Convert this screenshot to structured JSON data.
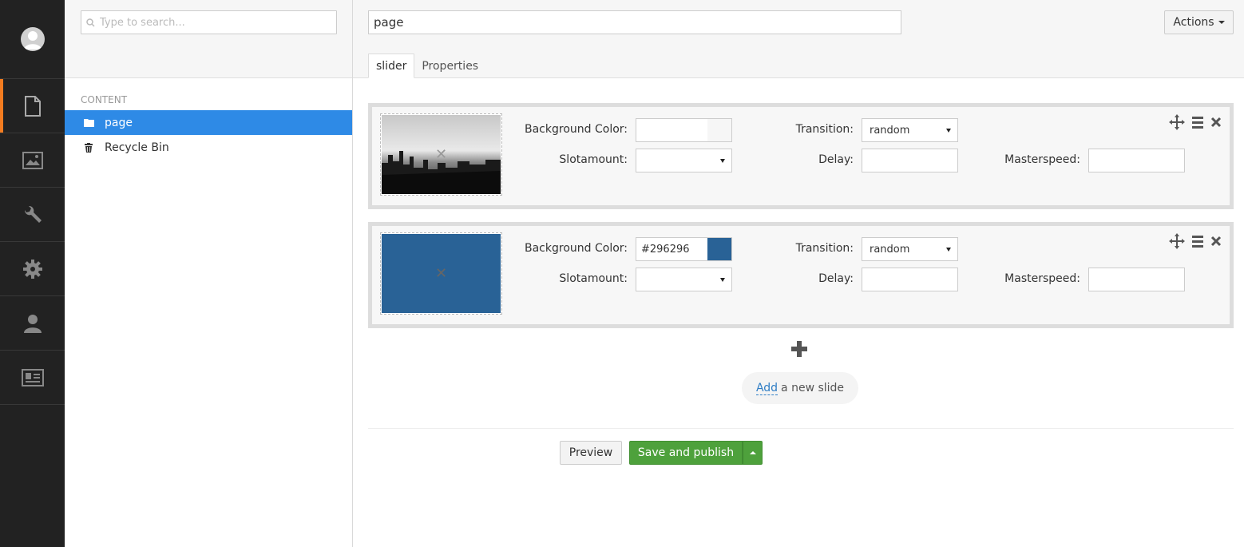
{
  "nav": {
    "items": [
      {
        "icon": "document-icon",
        "active": true
      },
      {
        "icon": "image-icon",
        "active": false
      },
      {
        "icon": "wrench-icon",
        "active": false
      },
      {
        "icon": "gear-icon",
        "active": false
      },
      {
        "icon": "user-icon",
        "active": false
      },
      {
        "icon": "id-card-icon",
        "active": false
      }
    ]
  },
  "tree": {
    "search_placeholder": "Type to search...",
    "section_label": "CONTENT",
    "items": [
      {
        "label": "page",
        "icon": "folder-icon",
        "selected": true
      },
      {
        "label": "Recycle Bin",
        "icon": "trash-icon",
        "selected": false
      }
    ]
  },
  "header": {
    "name_value": "page",
    "actions_label": "Actions",
    "tabs": [
      {
        "label": "slider",
        "active": true
      },
      {
        "label": "Properties",
        "active": false
      }
    ]
  },
  "slides": [
    {
      "image": "city-skyline-photo",
      "background_color_label": "Background Color:",
      "background_color_value": "",
      "swatch_color": "#f6f6f6",
      "transition_label": "Transition:",
      "transition_value": "random",
      "slotamount_label": "Slotamount:",
      "slotamount_value": "",
      "delay_label": "Delay:",
      "delay_value": "",
      "masterspeed_label": "Masterspeed:",
      "masterspeed_value": ""
    },
    {
      "image": "solid-color",
      "thumb_color": "#296296",
      "background_color_label": "Background Color:",
      "background_color_value": "#296296",
      "swatch_color": "#296296",
      "transition_label": "Transition:",
      "transition_value": "random",
      "slotamount_label": "Slotamount:",
      "slotamount_value": "",
      "delay_label": "Delay:",
      "delay_value": "",
      "masterspeed_label": "Masterspeed:",
      "masterspeed_value": ""
    }
  ],
  "add_slide": {
    "link_label": "Add",
    "rest_label": "a new slide"
  },
  "footer": {
    "preview_label": "Preview",
    "save_label": "Save and publish"
  },
  "colors": {
    "nav_bg": "#222222",
    "nav_active_accent": "#f47c20",
    "selected_row": "#2e8ae6",
    "save_green": "#4ea13c",
    "link_blue": "#2e7dc5"
  }
}
